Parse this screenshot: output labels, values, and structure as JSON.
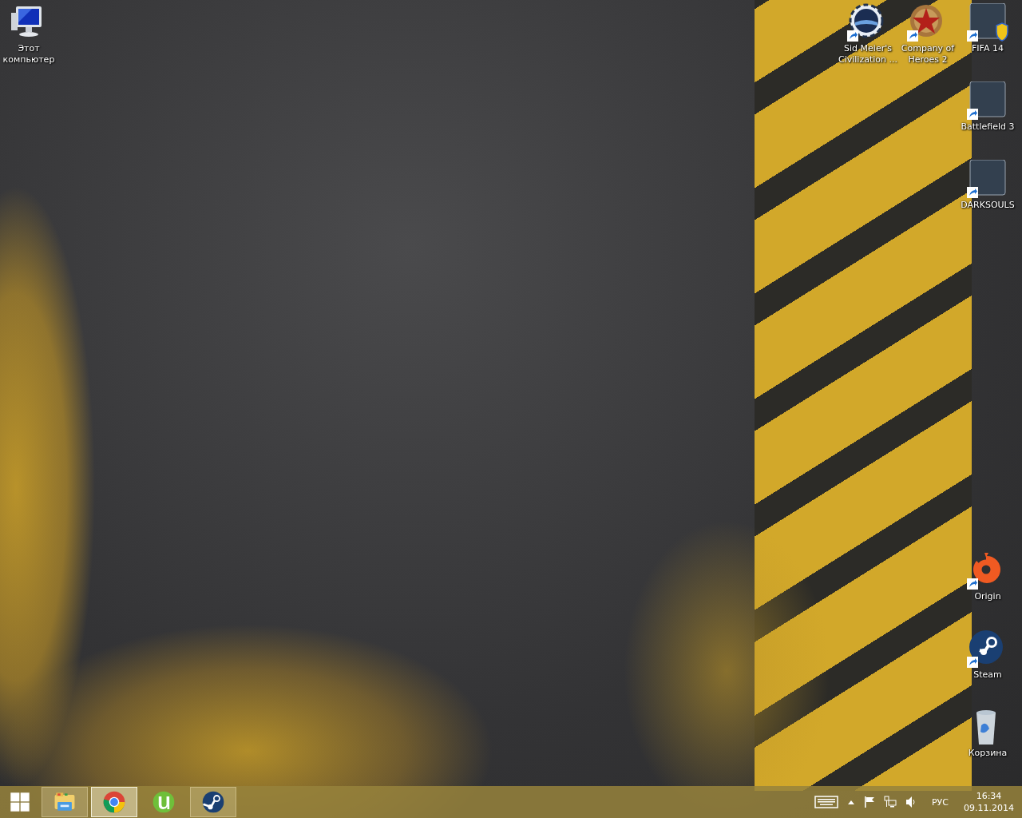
{
  "desktop_icons": [
    {
      "label": "Этот компьютер",
      "kind": "computer",
      "shortcut": false,
      "shield": false
    },
    {
      "label": "Sid Meier's Civilization ...",
      "kind": "emblem-ring",
      "shortcut": true,
      "shield": false
    },
    {
      "label": "Company of Heroes 2",
      "kind": "star-emblem",
      "shortcut": true,
      "shield": false
    },
    {
      "label": "FIFA 14",
      "kind": "artwork",
      "shortcut": true,
      "shield": true
    },
    {
      "label": "Battlefield 3",
      "kind": "artwork",
      "shortcut": true,
      "shield": false
    },
    {
      "label": "DARKSOULS",
      "kind": "artwork",
      "shortcut": true,
      "shield": false
    },
    {
      "label": "Origin",
      "kind": "origin",
      "shortcut": true,
      "shield": false
    },
    {
      "label": "Steam",
      "kind": "steam",
      "shortcut": true,
      "shield": false
    },
    {
      "label": "Корзина",
      "kind": "bin",
      "shortcut": false,
      "shield": false
    }
  ],
  "taskbar": {
    "items": [
      {
        "kind": "folder",
        "running": true,
        "active": false
      },
      {
        "kind": "browser",
        "running": true,
        "active": true
      },
      {
        "kind": "torrent",
        "running": false,
        "active": false
      },
      {
        "kind": "steam",
        "running": true,
        "active": false
      }
    ],
    "tray": {
      "language": "РУС",
      "time": "16:34",
      "date": "09.11.2014"
    }
  }
}
